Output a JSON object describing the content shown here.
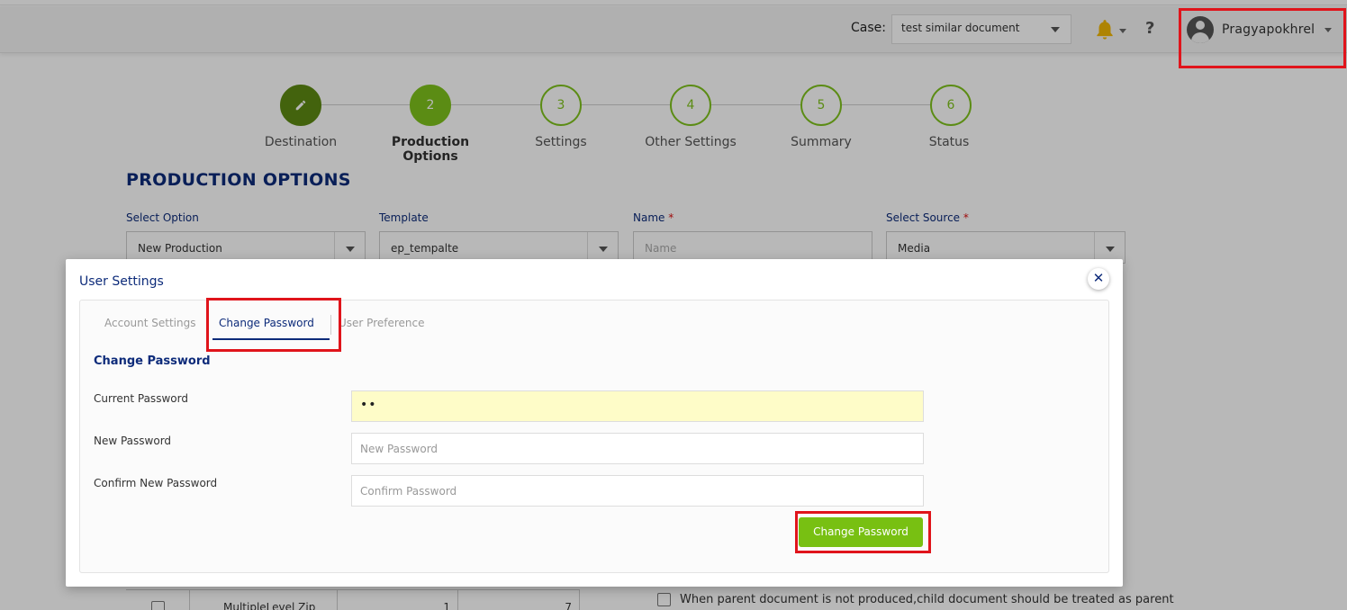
{
  "header": {
    "case_label": "Case:",
    "case_value": "test similar document",
    "help_label": "?",
    "username": "Pragyapokhrel"
  },
  "stepper": {
    "steps": [
      {
        "number": "",
        "label": "Destination",
        "state": "done"
      },
      {
        "number": "2",
        "label": "Production Options",
        "state": "active"
      },
      {
        "number": "3",
        "label": "Settings",
        "state": "pending"
      },
      {
        "number": "4",
        "label": "Other Settings",
        "state": "pending"
      },
      {
        "number": "5",
        "label": "Summary",
        "state": "pending"
      },
      {
        "number": "6",
        "label": "Status",
        "state": "pending"
      }
    ]
  },
  "production": {
    "title": "PRODUCTION OPTIONS",
    "fields": [
      {
        "label": "Select Option",
        "required": false,
        "value": "New Production"
      },
      {
        "label": "Template",
        "required": false,
        "value": "ep_tempalte"
      },
      {
        "label": "Name",
        "required": true,
        "placeholder": "Name"
      },
      {
        "label": "Select Source",
        "required": true,
        "value": "Media"
      }
    ],
    "required_marker": "*",
    "table_row": {
      "name": "MultipleLevel Zip",
      "col1": "1",
      "col2": "7"
    },
    "note": "When parent document is not produced,child document should be treated as parent"
  },
  "modal": {
    "title": "User Settings",
    "close_label": "✕",
    "tabs": [
      "Account Settings",
      "Change Password",
      "User Preference"
    ],
    "section_title": "Change Password",
    "fields": {
      "current_label": "Current Password",
      "current_value": "••",
      "new_label": "New Password",
      "new_placeholder": "New Password",
      "confirm_label": "Confirm New Password",
      "confirm_placeholder": "Confirm Password"
    },
    "submit_label": "Change Password"
  },
  "colors": {
    "accent_green": "#78c012",
    "navy": "#0d2b7a",
    "highlight_red": "#e0141b",
    "autofill_yellow": "#fefcc8"
  }
}
